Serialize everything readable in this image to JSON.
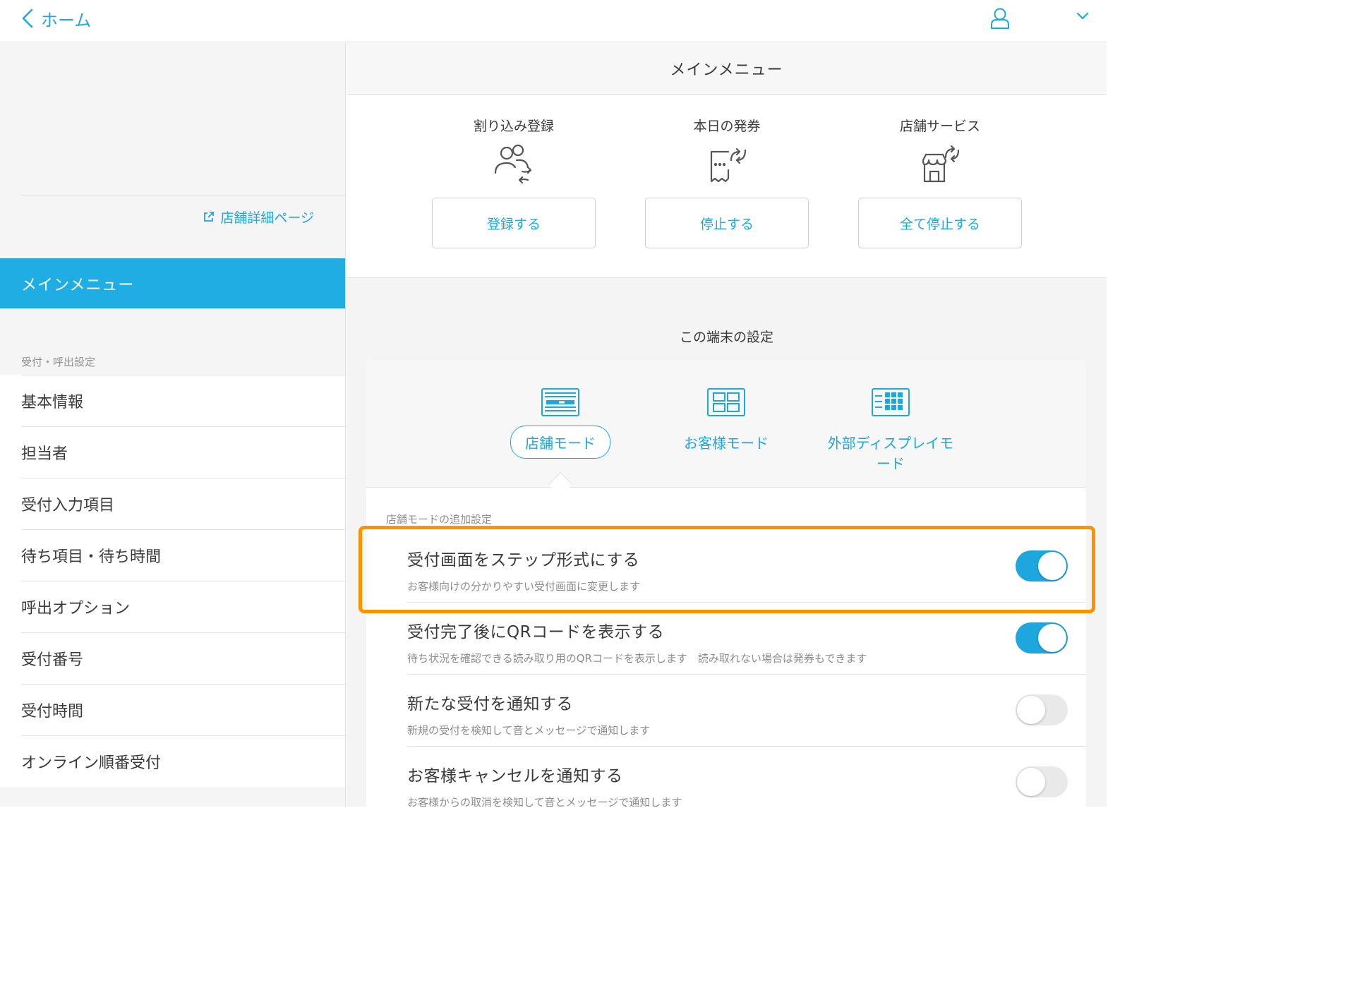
{
  "topbar": {
    "back_label": "ホーム"
  },
  "sidebar": {
    "store_link_label": "店舗詳細ページ",
    "active_item": "メインメニュー",
    "section_label": "受付・呼出設定",
    "items": [
      {
        "label": "基本情報"
      },
      {
        "label": "担当者"
      },
      {
        "label": "受付入力項目"
      },
      {
        "label": "待ち項目・待ち時間"
      },
      {
        "label": "呼出オプション"
      },
      {
        "label": "受付番号"
      },
      {
        "label": "受付時間"
      },
      {
        "label": "オンライン順番受付"
      }
    ]
  },
  "main": {
    "title": "メインメニュー",
    "actions": [
      {
        "label": "割り込み登録",
        "icon": "people-sync-icon",
        "button": "登録する"
      },
      {
        "label": "本日の発券",
        "icon": "ticket-sync-icon",
        "button": "停止する"
      },
      {
        "label": "店舗サービス",
        "icon": "store-sync-icon",
        "button": "全て停止する"
      }
    ],
    "device_settings_title": "この端末の設定",
    "modes": [
      {
        "label": "店舗モード",
        "icon": "store-mode-icon",
        "selected": true
      },
      {
        "label": "お客様モード",
        "icon": "customer-mode-icon",
        "selected": false
      },
      {
        "label": "外部ディスプレイモード",
        "icon": "external-display-mode-icon",
        "selected": false
      }
    ],
    "additional_settings_title": "店舗モードの追加設定",
    "settings": [
      {
        "title": "受付画面をステップ形式にする",
        "desc": "お客様向けの分かりやすい受付画面に変更します",
        "on": true
      },
      {
        "title": "受付完了後にQRコードを表示する",
        "desc": "待ち状況を確認できる読み取り用のQRコードを表示します　読み取れない場合は発券もできます",
        "on": true
      },
      {
        "title": "新たな受付を通知する",
        "desc": "新規の受付を検知して音とメッセージで通知します",
        "on": false
      },
      {
        "title": "お客様キャンセルを通知する",
        "desc": "お客様からの取消を検知して音とメッセージで通知します",
        "on": false
      }
    ]
  },
  "colors": {
    "accent": "#1ea6df",
    "sidebar_active": "#20ade3",
    "highlight": "#fb9200"
  }
}
